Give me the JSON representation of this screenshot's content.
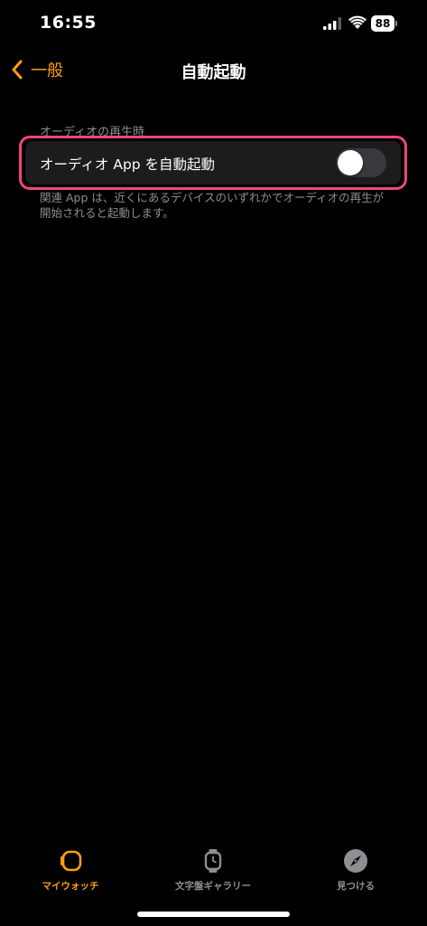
{
  "status_bar": {
    "time": "16:55",
    "battery": "88",
    "icons": [
      "cellular-signal-icon",
      "wifi-icon",
      "battery-icon"
    ]
  },
  "nav": {
    "back_label": "一般",
    "title": "自動起動"
  },
  "section": {
    "header": "オーディオの再生時",
    "row_label": "オーディオ App を自動起動",
    "toggle_on": false,
    "footer": "関連 App は、近くにあるデバイスのいずれかでオーディオの再生が開始されると起動します。"
  },
  "tabs": [
    {
      "label": "マイウォッチ",
      "icon": "my-watch-icon",
      "active": true
    },
    {
      "label": "文字盤ギャラリー",
      "icon": "face-gallery-icon",
      "active": false
    },
    {
      "label": "見つける",
      "icon": "discover-compass-icon",
      "active": false
    }
  ],
  "colors": {
    "accent": "#ff9f0a",
    "background": "#000000",
    "cell": "#1c1c1e",
    "highlight": "#f0457a",
    "secondary_text": "#8d8d93",
    "toggle_off": "#39393d"
  }
}
